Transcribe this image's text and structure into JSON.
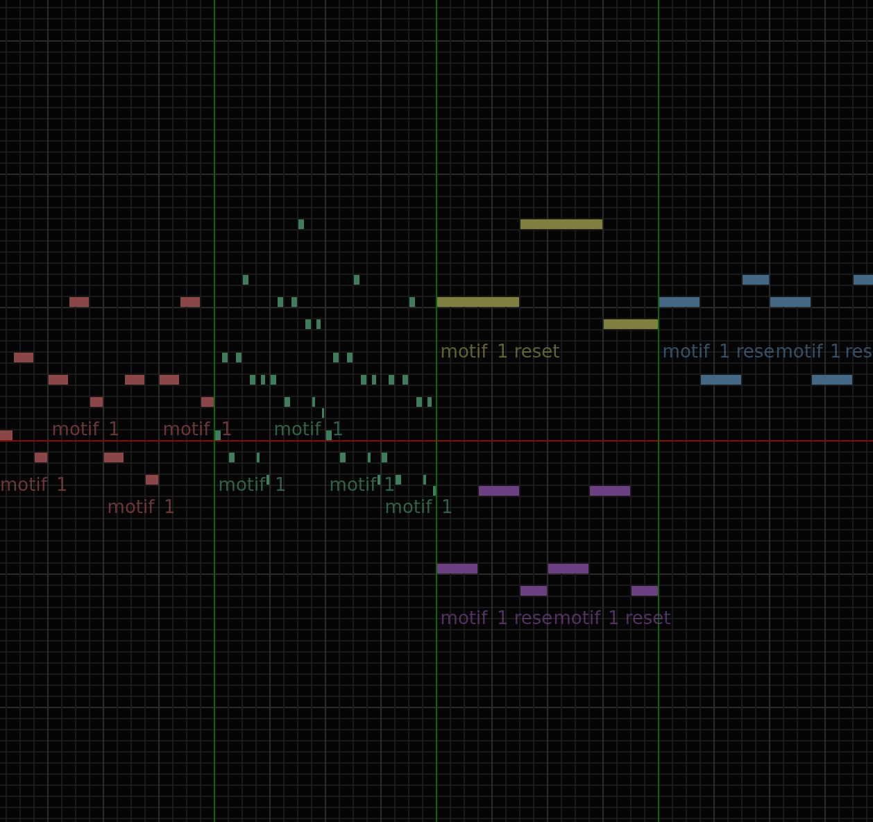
{
  "piano_roll": {
    "voices": [
      {
        "color": "#8b4747",
        "labels": [
          {
            "name": "motif",
            "number": "1"
          },
          {
            "name": "motif",
            "number": "1"
          },
          {
            "name": "motif",
            "number": "1"
          },
          {
            "name": "motif",
            "number": "1"
          }
        ]
      },
      {
        "color": "#3e7e5c",
        "labels": [
          {
            "name": "motif",
            "number": "1"
          },
          {
            "name": "motif",
            "number": "1"
          },
          {
            "name": "motif",
            "number": "1"
          },
          {
            "name": "motif",
            "number": "1"
          }
        ]
      },
      {
        "color": "#7f7f40",
        "labels": [
          {
            "name": "motif",
            "number": "1",
            "suffix": "reset"
          }
        ]
      },
      {
        "color": "#436885",
        "labels": [
          {
            "name": "motif",
            "number": "1",
            "suffix": "rese"
          },
          {
            "name": "motif",
            "number": "1",
            "suffix": "res"
          }
        ]
      },
      {
        "color": "#6b3f82",
        "labels": [
          {
            "name": "motif",
            "number": "1",
            "suffix": "rese"
          },
          {
            "name": "motif",
            "number": "1",
            "suffix": "reset"
          }
        ]
      }
    ]
  }
}
